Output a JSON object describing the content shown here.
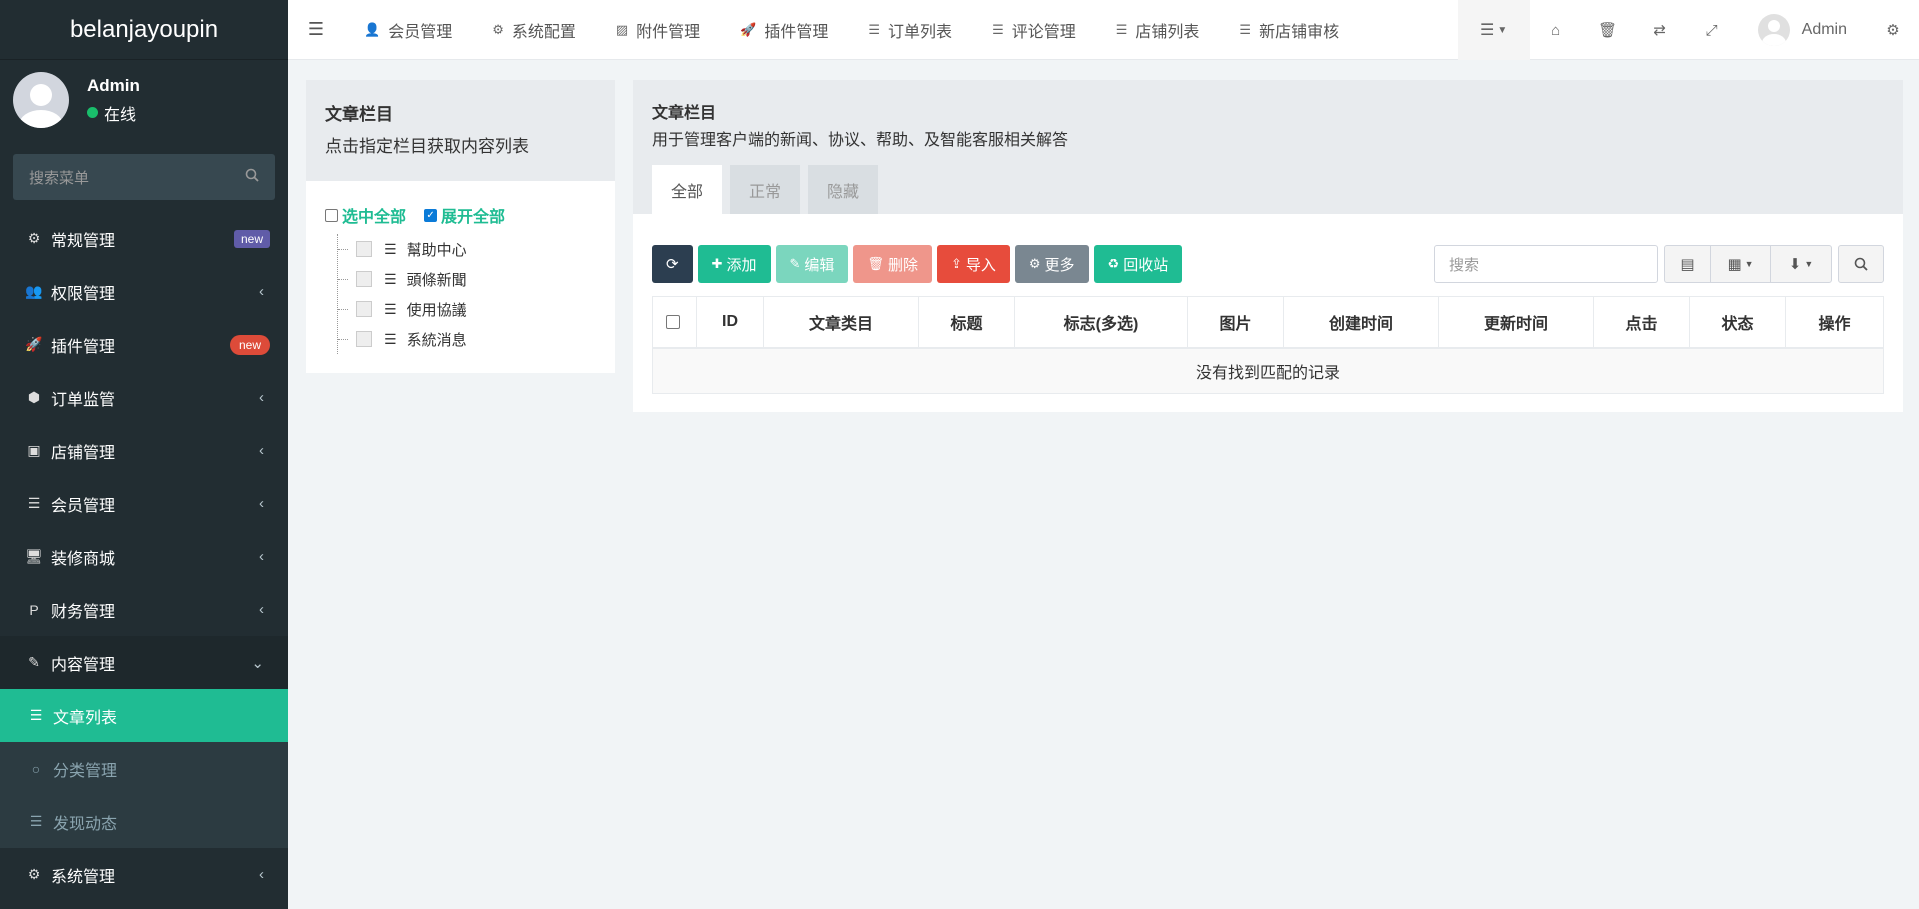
{
  "app": {
    "brand": "belanjayoupin"
  },
  "user": {
    "name": "Admin",
    "status": "在线"
  },
  "sidebar": {
    "search_placeholder": "搜索菜单",
    "items": [
      {
        "label": "常规管理",
        "icon": "cogs-icon",
        "badge": "new"
      },
      {
        "label": "权限管理",
        "icon": "users-icon",
        "chevron": "‹"
      },
      {
        "label": "插件管理",
        "icon": "rocket-icon",
        "badge": "new"
      },
      {
        "label": "订单监管",
        "icon": "cube-icon",
        "chevron": "‹"
      },
      {
        "label": "店铺管理",
        "icon": "archive-icon",
        "chevron": "‹"
      },
      {
        "label": "会员管理",
        "icon": "list-icon",
        "chevron": "‹"
      },
      {
        "label": "装修商城",
        "icon": "desktop-icon",
        "chevron": "‹"
      },
      {
        "label": "财务管理",
        "icon": "paypal-icon",
        "chevron": "‹"
      },
      {
        "label": "内容管理",
        "icon": "edit-icon",
        "chevron": "⌄"
      }
    ],
    "subitems": [
      {
        "label": "文章列表",
        "icon": "list-icon"
      },
      {
        "label": "分类管理",
        "icon": "circle-icon"
      },
      {
        "label": "发现动态",
        "icon": "list-icon"
      }
    ],
    "last_item": {
      "label": "系统管理",
      "icon": "cog-icon",
      "chevron": "‹"
    }
  },
  "header": {
    "nav": [
      {
        "label": "会员管理",
        "icon": "user-icon"
      },
      {
        "label": "系统配置",
        "icon": "cog-icon"
      },
      {
        "label": "附件管理",
        "icon": "image-icon"
      },
      {
        "label": "插件管理",
        "icon": "rocket-icon"
      },
      {
        "label": "订单列表",
        "icon": "list-icon"
      },
      {
        "label": "评论管理",
        "icon": "list-icon"
      },
      {
        "label": "店铺列表",
        "icon": "list-icon"
      },
      {
        "label": "新店铺审核",
        "icon": "list-icon"
      }
    ],
    "user_name": "Admin"
  },
  "category_panel": {
    "title": "文章栏目",
    "subtitle": "点击指定栏目获取内容列表",
    "select_all": "选中全部",
    "expand_all": "展开全部",
    "nodes": [
      "幫助中心",
      "頭條新聞",
      "使用協議",
      "系統消息"
    ]
  },
  "content_panel": {
    "title": "文章栏目",
    "subtitle": "用于管理客户端的新闻、协议、帮助、及智能客服相关解答",
    "tabs": [
      "全部",
      "正常",
      "隐藏"
    ],
    "buttons": {
      "add": "添加",
      "edit": "编辑",
      "delete": "删除",
      "import": "导入",
      "more": "更多",
      "recycle": "回收站"
    },
    "search_placeholder": "搜索",
    "columns": [
      "ID",
      "文章类目",
      "标题",
      "标志(多选)",
      "图片",
      "创建时间",
      "更新时间",
      "点击",
      "状态",
      "操作"
    ],
    "empty_text": "没有找到匹配的记录"
  }
}
